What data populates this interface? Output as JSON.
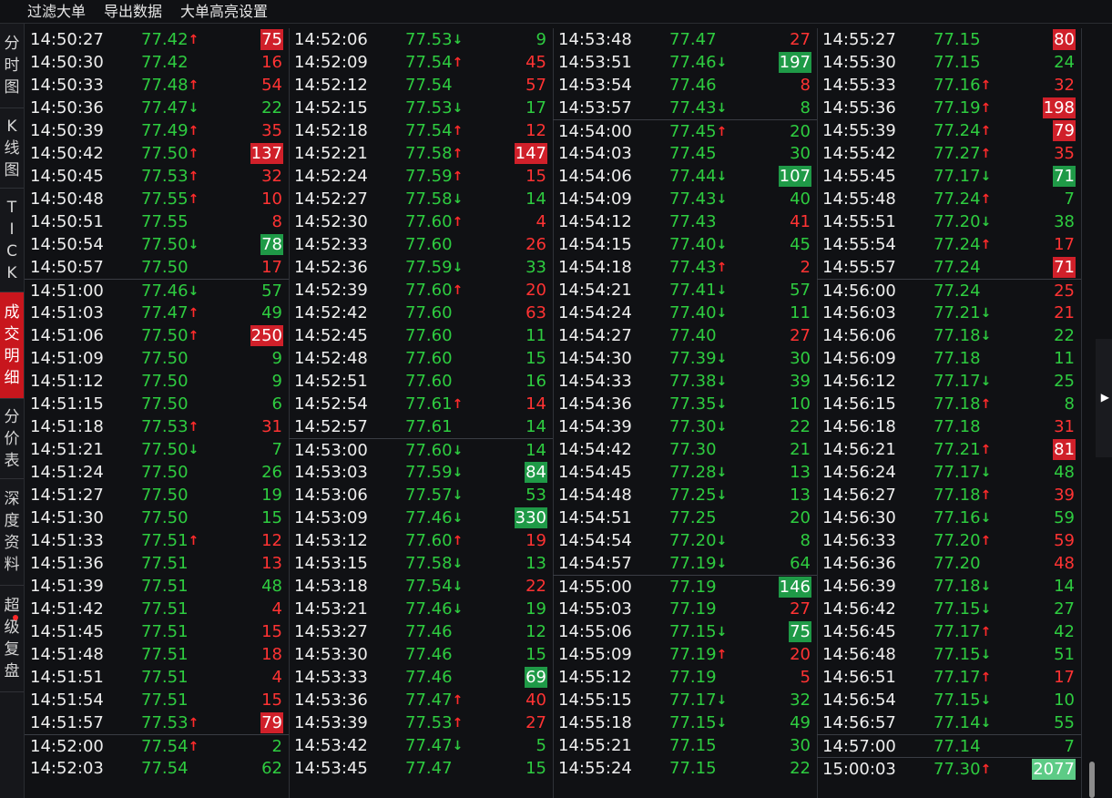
{
  "toolbar": {
    "filter_label": "过滤大单",
    "export_label": "导出数据",
    "highlight_label": "大单高亮设置"
  },
  "side_tabs": [
    {
      "label": "分时图"
    },
    {
      "label": "K线图"
    },
    {
      "label": "TICK"
    },
    {
      "label": "成交明细",
      "active": true
    },
    {
      "label": "分价表"
    },
    {
      "label": "深度资料"
    },
    {
      "label": "超级复盘",
      "badge_dot": true
    }
  ],
  "colors": {
    "up": "#ff2b2b",
    "down": "#2ecc40",
    "highlight_red": "#d0202a",
    "highlight_green": "#1f9a47"
  },
  "columns": [
    [
      {
        "time": "14:50:27",
        "price": "77.42",
        "arrow": "up",
        "vol": "75",
        "vc": "hl-red"
      },
      {
        "time": "14:50:30",
        "price": "77.42",
        "arrow": "",
        "vol": "16",
        "vc": "red"
      },
      {
        "time": "14:50:33",
        "price": "77.48",
        "arrow": "up",
        "vol": "54",
        "vc": "red"
      },
      {
        "time": "14:50:36",
        "price": "77.47",
        "arrow": "down",
        "vol": "22",
        "vc": "green"
      },
      {
        "time": "14:50:39",
        "price": "77.49",
        "arrow": "up",
        "vol": "35",
        "vc": "red"
      },
      {
        "time": "14:50:42",
        "price": "77.50",
        "arrow": "up",
        "vol": "137",
        "vc": "hl-red"
      },
      {
        "time": "14:50:45",
        "price": "77.53",
        "arrow": "up",
        "vol": "32",
        "vc": "red"
      },
      {
        "time": "14:50:48",
        "price": "77.55",
        "arrow": "up",
        "vol": "10",
        "vc": "red"
      },
      {
        "time": "14:50:51",
        "price": "77.55",
        "arrow": "",
        "vol": "8",
        "vc": "red"
      },
      {
        "time": "14:50:54",
        "price": "77.50",
        "arrow": "down",
        "vol": "78",
        "vc": "hl-green"
      },
      {
        "time": "14:50:57",
        "price": "77.50",
        "arrow": "",
        "vol": "17",
        "vc": "red"
      },
      {
        "time": "14:51:00",
        "price": "77.46",
        "arrow": "down",
        "vol": "57",
        "vc": "green",
        "sep": true
      },
      {
        "time": "14:51:03",
        "price": "77.47",
        "arrow": "up",
        "vol": "49",
        "vc": "green"
      },
      {
        "time": "14:51:06",
        "price": "77.50",
        "arrow": "up",
        "vol": "250",
        "vc": "hl-red"
      },
      {
        "time": "14:51:09",
        "price": "77.50",
        "arrow": "",
        "vol": "9",
        "vc": "green"
      },
      {
        "time": "14:51:12",
        "price": "77.50",
        "arrow": "",
        "vol": "9",
        "vc": "green"
      },
      {
        "time": "14:51:15",
        "price": "77.50",
        "arrow": "",
        "vol": "6",
        "vc": "green"
      },
      {
        "time": "14:51:18",
        "price": "77.53",
        "arrow": "up",
        "vol": "31",
        "vc": "red"
      },
      {
        "time": "14:51:21",
        "price": "77.50",
        "arrow": "down",
        "vol": "7",
        "vc": "green"
      },
      {
        "time": "14:51:24",
        "price": "77.50",
        "arrow": "",
        "vol": "26",
        "vc": "green"
      },
      {
        "time": "14:51:27",
        "price": "77.50",
        "arrow": "",
        "vol": "19",
        "vc": "green"
      },
      {
        "time": "14:51:30",
        "price": "77.50",
        "arrow": "",
        "vol": "15",
        "vc": "green"
      },
      {
        "time": "14:51:33",
        "price": "77.51",
        "arrow": "up",
        "vol": "12",
        "vc": "red"
      },
      {
        "time": "14:51:36",
        "price": "77.51",
        "arrow": "",
        "vol": "13",
        "vc": "red"
      },
      {
        "time": "14:51:39",
        "price": "77.51",
        "arrow": "",
        "vol": "48",
        "vc": "green"
      },
      {
        "time": "14:51:42",
        "price": "77.51",
        "arrow": "",
        "vol": "4",
        "vc": "red"
      },
      {
        "time": "14:51:45",
        "price": "77.51",
        "arrow": "",
        "vol": "15",
        "vc": "red"
      },
      {
        "time": "14:51:48",
        "price": "77.51",
        "arrow": "",
        "vol": "18",
        "vc": "red"
      },
      {
        "time": "14:51:51",
        "price": "77.51",
        "arrow": "",
        "vol": "4",
        "vc": "red"
      },
      {
        "time": "14:51:54",
        "price": "77.51",
        "arrow": "",
        "vol": "15",
        "vc": "red"
      },
      {
        "time": "14:51:57",
        "price": "77.53",
        "arrow": "up",
        "vol": "79",
        "vc": "hl-red"
      },
      {
        "time": "14:52:00",
        "price": "77.54",
        "arrow": "up",
        "vol": "2",
        "vc": "green",
        "sep": true
      },
      {
        "time": "14:52:03",
        "price": "77.54",
        "arrow": "",
        "vol": "62",
        "vc": "green"
      }
    ],
    [
      {
        "time": "14:52:06",
        "price": "77.53",
        "arrow": "down",
        "vol": "9",
        "vc": "green"
      },
      {
        "time": "14:52:09",
        "price": "77.54",
        "arrow": "up",
        "vol": "45",
        "vc": "red"
      },
      {
        "time": "14:52:12",
        "price": "77.54",
        "arrow": "",
        "vol": "57",
        "vc": "red"
      },
      {
        "time": "14:52:15",
        "price": "77.53",
        "arrow": "down",
        "vol": "17",
        "vc": "green"
      },
      {
        "time": "14:52:18",
        "price": "77.54",
        "arrow": "up",
        "vol": "12",
        "vc": "red"
      },
      {
        "time": "14:52:21",
        "price": "77.58",
        "arrow": "up",
        "vol": "147",
        "vc": "hl-red"
      },
      {
        "time": "14:52:24",
        "price": "77.59",
        "arrow": "up",
        "vol": "15",
        "vc": "red"
      },
      {
        "time": "14:52:27",
        "price": "77.58",
        "arrow": "down",
        "vol": "14",
        "vc": "green"
      },
      {
        "time": "14:52:30",
        "price": "77.60",
        "arrow": "up",
        "vol": "4",
        "vc": "red"
      },
      {
        "time": "14:52:33",
        "price": "77.60",
        "arrow": "",
        "vol": "26",
        "vc": "red"
      },
      {
        "time": "14:52:36",
        "price": "77.59",
        "arrow": "down",
        "vol": "33",
        "vc": "green"
      },
      {
        "time": "14:52:39",
        "price": "77.60",
        "arrow": "up",
        "vol": "20",
        "vc": "red"
      },
      {
        "time": "14:52:42",
        "price": "77.60",
        "arrow": "",
        "vol": "63",
        "vc": "red"
      },
      {
        "time": "14:52:45",
        "price": "77.60",
        "arrow": "",
        "vol": "11",
        "vc": "green"
      },
      {
        "time": "14:52:48",
        "price": "77.60",
        "arrow": "",
        "vol": "15",
        "vc": "green"
      },
      {
        "time": "14:52:51",
        "price": "77.60",
        "arrow": "",
        "vol": "16",
        "vc": "green"
      },
      {
        "time": "14:52:54",
        "price": "77.61",
        "arrow": "up",
        "vol": "14",
        "vc": "red"
      },
      {
        "time": "14:52:57",
        "price": "77.61",
        "arrow": "",
        "vol": "14",
        "vc": "green"
      },
      {
        "time": "14:53:00",
        "price": "77.60",
        "arrow": "down",
        "vol": "14",
        "vc": "green",
        "sep": true
      },
      {
        "time": "14:53:03",
        "price": "77.59",
        "arrow": "down",
        "vol": "84",
        "vc": "hl-green"
      },
      {
        "time": "14:53:06",
        "price": "77.57",
        "arrow": "down",
        "vol": "53",
        "vc": "green"
      },
      {
        "time": "14:53:09",
        "price": "77.46",
        "arrow": "down",
        "vol": "330",
        "vc": "hl-green"
      },
      {
        "time": "14:53:12",
        "price": "77.60",
        "arrow": "up",
        "vol": "19",
        "vc": "red"
      },
      {
        "time": "14:53:15",
        "price": "77.58",
        "arrow": "down",
        "vol": "13",
        "vc": "green"
      },
      {
        "time": "14:53:18",
        "price": "77.54",
        "arrow": "down",
        "vol": "22",
        "vc": "red"
      },
      {
        "time": "14:53:21",
        "price": "77.46",
        "arrow": "down",
        "vol": "19",
        "vc": "green"
      },
      {
        "time": "14:53:27",
        "price": "77.46",
        "arrow": "",
        "vol": "12",
        "vc": "green"
      },
      {
        "time": "14:53:30",
        "price": "77.46",
        "arrow": "",
        "vol": "15",
        "vc": "green"
      },
      {
        "time": "14:53:33",
        "price": "77.46",
        "arrow": "",
        "vol": "69",
        "vc": "hl-green"
      },
      {
        "time": "14:53:36",
        "price": "77.47",
        "arrow": "up",
        "vol": "40",
        "vc": "red"
      },
      {
        "time": "14:53:39",
        "price": "77.53",
        "arrow": "up",
        "vol": "27",
        "vc": "red"
      },
      {
        "time": "14:53:42",
        "price": "77.47",
        "arrow": "down",
        "vol": "5",
        "vc": "green"
      },
      {
        "time": "14:53:45",
        "price": "77.47",
        "arrow": "",
        "vol": "15",
        "vc": "green"
      }
    ],
    [
      {
        "time": "14:53:48",
        "price": "77.47",
        "arrow": "",
        "vol": "27",
        "vc": "red"
      },
      {
        "time": "14:53:51",
        "price": "77.46",
        "arrow": "down",
        "vol": "197",
        "vc": "hl-green"
      },
      {
        "time": "14:53:54",
        "price": "77.46",
        "arrow": "",
        "vol": "8",
        "vc": "red"
      },
      {
        "time": "14:53:57",
        "price": "77.43",
        "arrow": "down",
        "vol": "8",
        "vc": "green"
      },
      {
        "time": "14:54:00",
        "price": "77.45",
        "arrow": "up",
        "vol": "20",
        "vc": "green",
        "sep": true
      },
      {
        "time": "14:54:03",
        "price": "77.45",
        "arrow": "",
        "vol": "30",
        "vc": "green"
      },
      {
        "time": "14:54:06",
        "price": "77.44",
        "arrow": "down",
        "vol": "107",
        "vc": "hl-green"
      },
      {
        "time": "14:54:09",
        "price": "77.43",
        "arrow": "down",
        "vol": "40",
        "vc": "green"
      },
      {
        "time": "14:54:12",
        "price": "77.43",
        "arrow": "",
        "vol": "41",
        "vc": "red"
      },
      {
        "time": "14:54:15",
        "price": "77.40",
        "arrow": "down",
        "vol": "45",
        "vc": "green"
      },
      {
        "time": "14:54:18",
        "price": "77.43",
        "arrow": "up",
        "vol": "2",
        "vc": "red"
      },
      {
        "time": "14:54:21",
        "price": "77.41",
        "arrow": "down",
        "vol": "57",
        "vc": "green"
      },
      {
        "time": "14:54:24",
        "price": "77.40",
        "arrow": "down",
        "vol": "11",
        "vc": "green"
      },
      {
        "time": "14:54:27",
        "price": "77.40",
        "arrow": "",
        "vol": "27",
        "vc": "red"
      },
      {
        "time": "14:54:30",
        "price": "77.39",
        "arrow": "down",
        "vol": "30",
        "vc": "green"
      },
      {
        "time": "14:54:33",
        "price": "77.38",
        "arrow": "down",
        "vol": "39",
        "vc": "green"
      },
      {
        "time": "14:54:36",
        "price": "77.35",
        "arrow": "down",
        "vol": "10",
        "vc": "green"
      },
      {
        "time": "14:54:39",
        "price": "77.30",
        "arrow": "down",
        "vol": "22",
        "vc": "green"
      },
      {
        "time": "14:54:42",
        "price": "77.30",
        "arrow": "",
        "vol": "21",
        "vc": "green"
      },
      {
        "time": "14:54:45",
        "price": "77.28",
        "arrow": "down",
        "vol": "13",
        "vc": "green"
      },
      {
        "time": "14:54:48",
        "price": "77.25",
        "arrow": "down",
        "vol": "13",
        "vc": "green"
      },
      {
        "time": "14:54:51",
        "price": "77.25",
        "arrow": "",
        "vol": "20",
        "vc": "green"
      },
      {
        "time": "14:54:54",
        "price": "77.20",
        "arrow": "down",
        "vol": "8",
        "vc": "green"
      },
      {
        "time": "14:54:57",
        "price": "77.19",
        "arrow": "down",
        "vol": "64",
        "vc": "green"
      },
      {
        "time": "14:55:00",
        "price": "77.19",
        "arrow": "",
        "vol": "146",
        "vc": "hl-green",
        "sep": true
      },
      {
        "time": "14:55:03",
        "price": "77.19",
        "arrow": "",
        "vol": "27",
        "vc": "red"
      },
      {
        "time": "14:55:06",
        "price": "77.15",
        "arrow": "down",
        "vol": "75",
        "vc": "hl-green"
      },
      {
        "time": "14:55:09",
        "price": "77.19",
        "arrow": "up",
        "vol": "20",
        "vc": "red"
      },
      {
        "time": "14:55:12",
        "price": "77.19",
        "arrow": "",
        "vol": "5",
        "vc": "red"
      },
      {
        "time": "14:55:15",
        "price": "77.17",
        "arrow": "down",
        "vol": "32",
        "vc": "green"
      },
      {
        "time": "14:55:18",
        "price": "77.15",
        "arrow": "down",
        "vol": "49",
        "vc": "green"
      },
      {
        "time": "14:55:21",
        "price": "77.15",
        "arrow": "",
        "vol": "30",
        "vc": "green"
      },
      {
        "time": "14:55:24",
        "price": "77.15",
        "arrow": "",
        "vol": "22",
        "vc": "green"
      }
    ],
    [
      {
        "time": "14:55:27",
        "price": "77.15",
        "arrow": "",
        "vol": "80",
        "vc": "hl-red"
      },
      {
        "time": "14:55:30",
        "price": "77.15",
        "arrow": "",
        "vol": "24",
        "vc": "green"
      },
      {
        "time": "14:55:33",
        "price": "77.16",
        "arrow": "up",
        "vol": "32",
        "vc": "red"
      },
      {
        "time": "14:55:36",
        "price": "77.19",
        "arrow": "up",
        "vol": "198",
        "vc": "hl-red"
      },
      {
        "time": "14:55:39",
        "price": "77.24",
        "arrow": "up",
        "vol": "79",
        "vc": "hl-red"
      },
      {
        "time": "14:55:42",
        "price": "77.27",
        "arrow": "up",
        "vol": "35",
        "vc": "red"
      },
      {
        "time": "14:55:45",
        "price": "77.17",
        "arrow": "down",
        "vol": "71",
        "vc": "hl-green"
      },
      {
        "time": "14:55:48",
        "price": "77.24",
        "arrow": "up",
        "vol": "7",
        "vc": "green"
      },
      {
        "time": "14:55:51",
        "price": "77.20",
        "arrow": "down",
        "vol": "38",
        "vc": "green"
      },
      {
        "time": "14:55:54",
        "price": "77.24",
        "arrow": "up",
        "vol": "17",
        "vc": "red"
      },
      {
        "time": "14:55:57",
        "price": "77.24",
        "arrow": "",
        "vol": "71",
        "vc": "hl-red"
      },
      {
        "time": "14:56:00",
        "price": "77.24",
        "arrow": "",
        "vol": "25",
        "vc": "red",
        "sep": true
      },
      {
        "time": "14:56:03",
        "price": "77.21",
        "arrow": "down",
        "vol": "21",
        "vc": "red"
      },
      {
        "time": "14:56:06",
        "price": "77.18",
        "arrow": "down",
        "vol": "22",
        "vc": "green"
      },
      {
        "time": "14:56:09",
        "price": "77.18",
        "arrow": "",
        "vol": "11",
        "vc": "green"
      },
      {
        "time": "14:56:12",
        "price": "77.17",
        "arrow": "down",
        "vol": "25",
        "vc": "green"
      },
      {
        "time": "14:56:15",
        "price": "77.18",
        "arrow": "up",
        "vol": "8",
        "vc": "green"
      },
      {
        "time": "14:56:18",
        "price": "77.18",
        "arrow": "",
        "vol": "31",
        "vc": "red"
      },
      {
        "time": "14:56:21",
        "price": "77.21",
        "arrow": "up",
        "vol": "81",
        "vc": "hl-red"
      },
      {
        "time": "14:56:24",
        "price": "77.17",
        "arrow": "down",
        "vol": "48",
        "vc": "green"
      },
      {
        "time": "14:56:27",
        "price": "77.18",
        "arrow": "up",
        "vol": "39",
        "vc": "red"
      },
      {
        "time": "14:56:30",
        "price": "77.16",
        "arrow": "down",
        "vol": "59",
        "vc": "green"
      },
      {
        "time": "14:56:33",
        "price": "77.20",
        "arrow": "up",
        "vol": "59",
        "vc": "red"
      },
      {
        "time": "14:56:36",
        "price": "77.20",
        "arrow": "",
        "vol": "48",
        "vc": "red"
      },
      {
        "time": "14:56:39",
        "price": "77.18",
        "arrow": "down",
        "vol": "14",
        "vc": "green"
      },
      {
        "time": "14:56:42",
        "price": "77.15",
        "arrow": "down",
        "vol": "27",
        "vc": "green"
      },
      {
        "time": "14:56:45",
        "price": "77.17",
        "arrow": "up",
        "vol": "42",
        "vc": "green"
      },
      {
        "time": "14:56:48",
        "price": "77.15",
        "arrow": "down",
        "vol": "51",
        "vc": "green"
      },
      {
        "time": "14:56:51",
        "price": "77.17",
        "arrow": "up",
        "vol": "17",
        "vc": "red"
      },
      {
        "time": "14:56:54",
        "price": "77.15",
        "arrow": "down",
        "vol": "10",
        "vc": "green"
      },
      {
        "time": "14:56:57",
        "price": "77.14",
        "arrow": "down",
        "vol": "55",
        "vc": "green"
      },
      {
        "time": "14:57:00",
        "price": "77.14",
        "arrow": "",
        "vol": "7",
        "vc": "green",
        "sep": true
      },
      {
        "time": "15:00:03",
        "price": "77.30",
        "arrow": "up",
        "vol": "2077",
        "vc": "hl-big",
        "sep": true
      }
    ]
  ]
}
